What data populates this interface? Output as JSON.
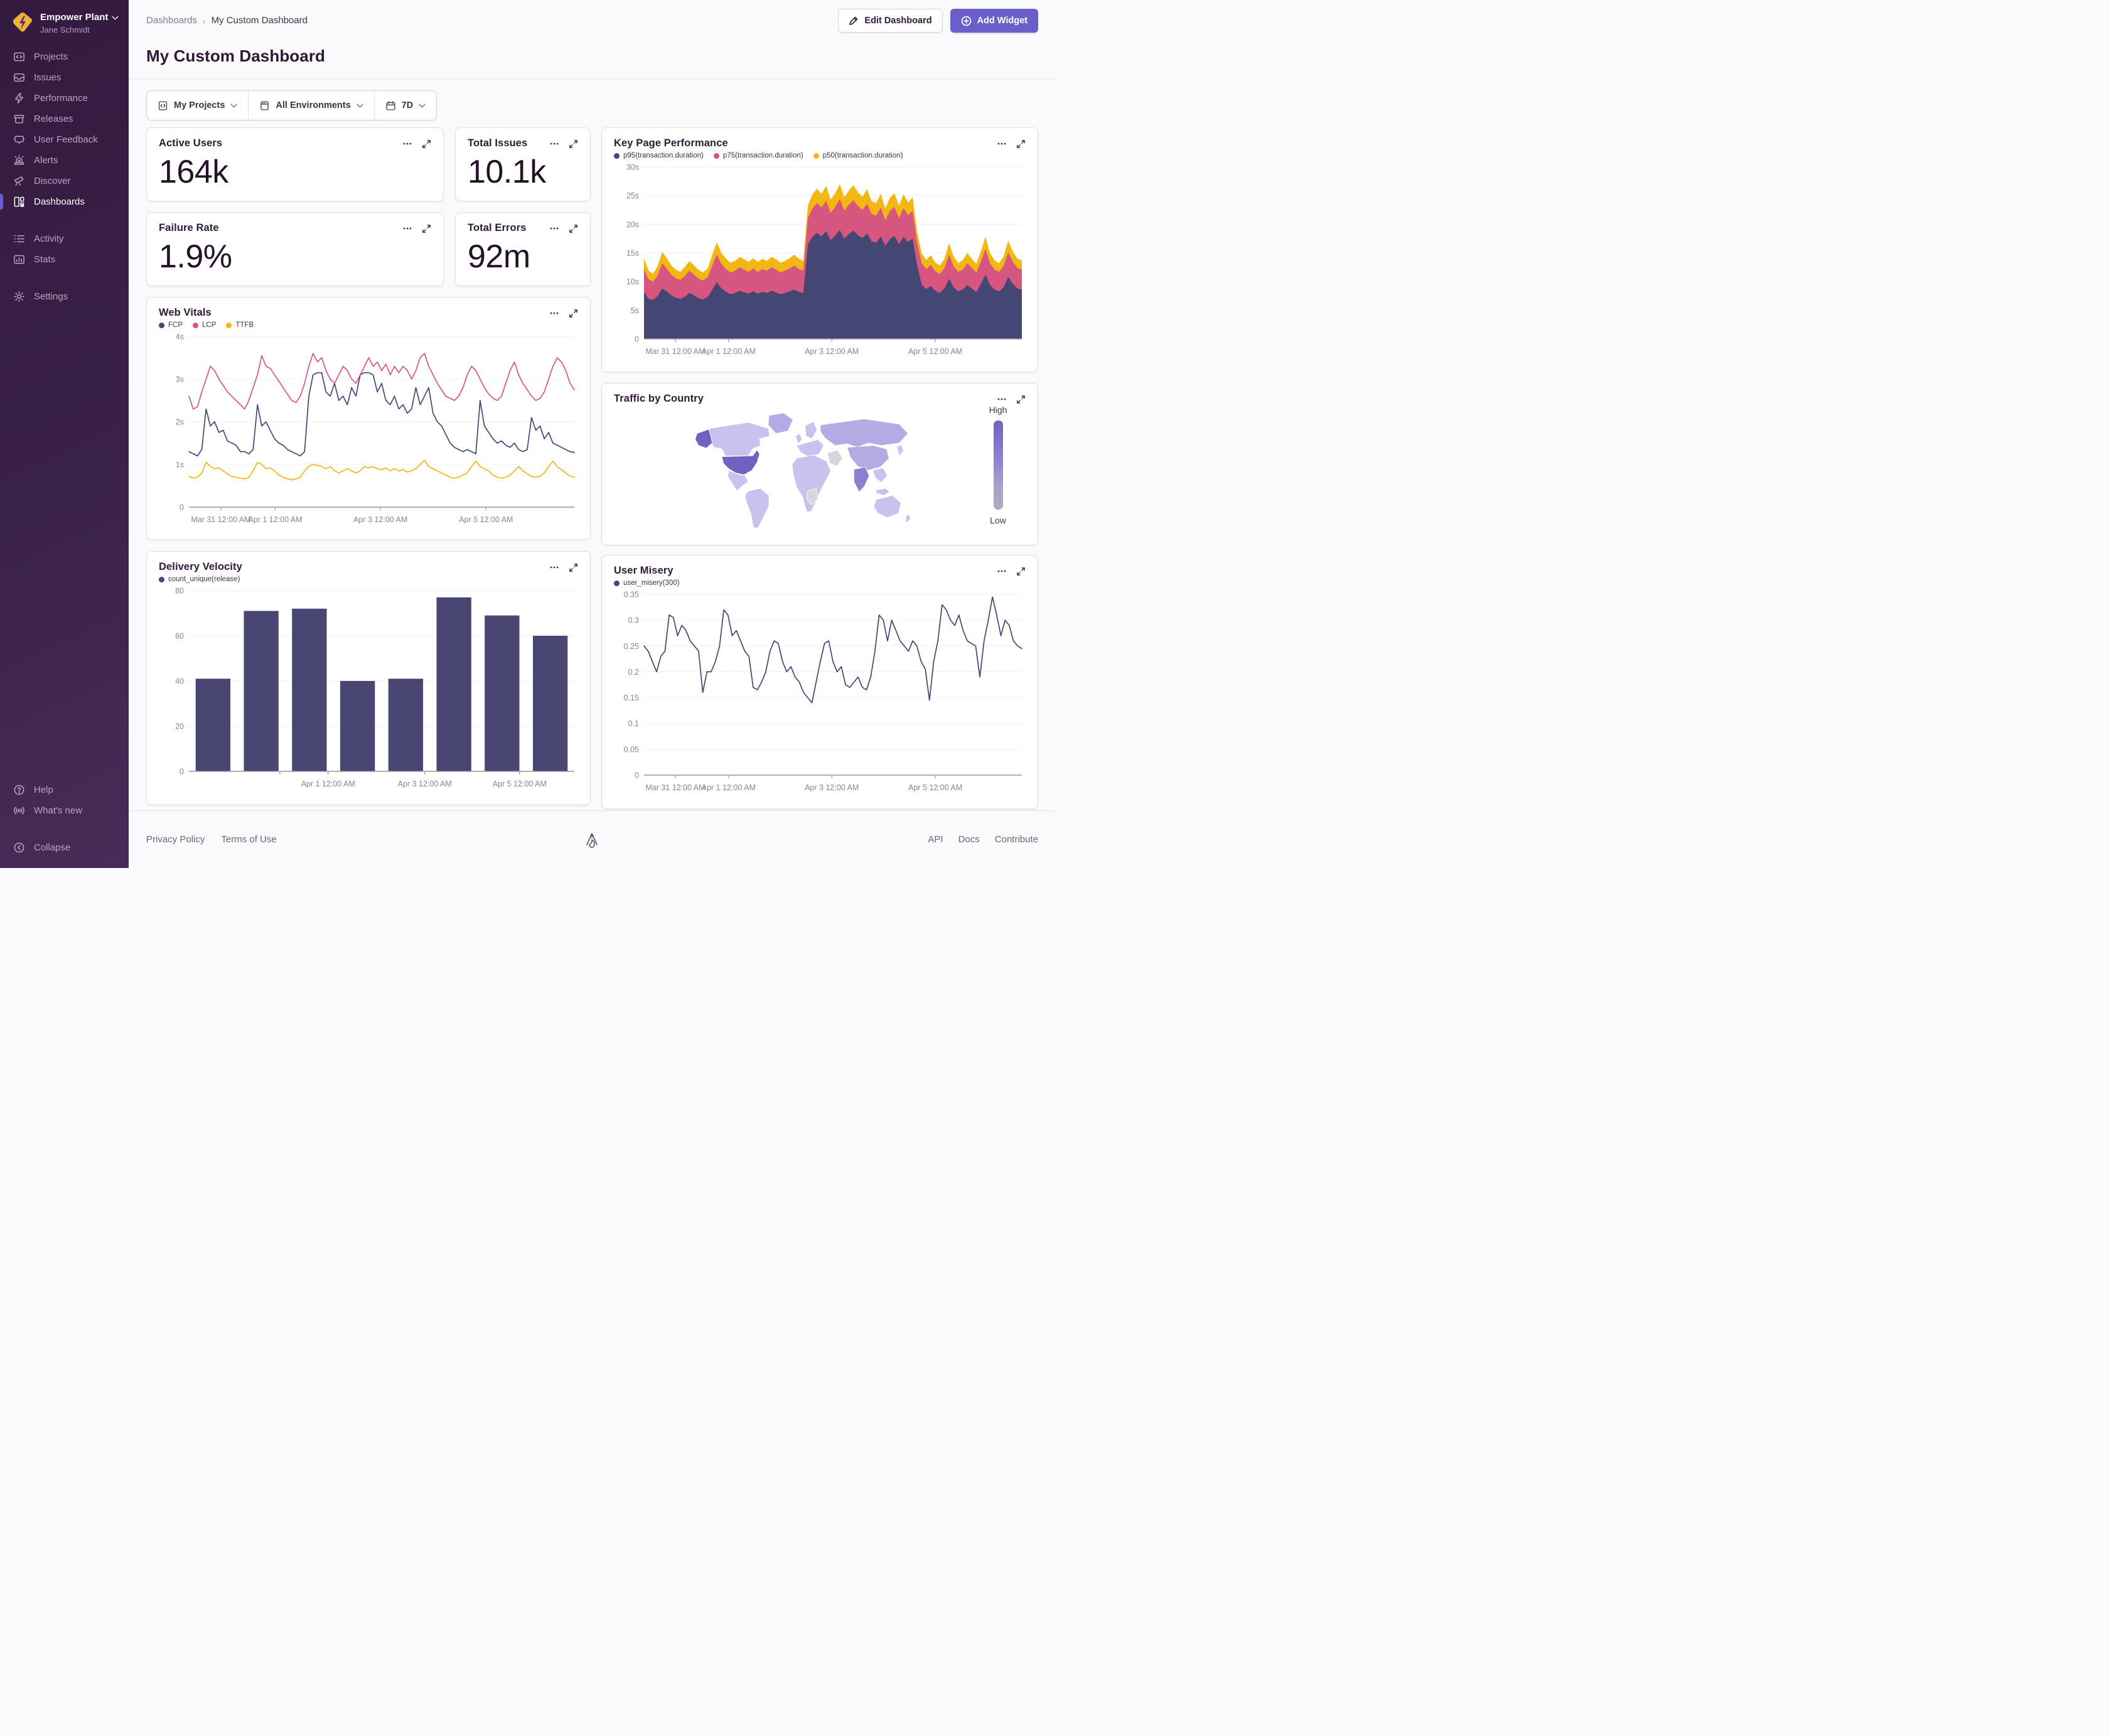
{
  "colors": {
    "accent": "#6a5fc8",
    "navy": "#444674",
    "pink": "#d6567f",
    "yellow": "#f2b712",
    "bar": "#4a4673",
    "map-base": "#c9c2ee",
    "map-mid": "#b3abe4",
    "map-med": "#8d7fd0",
    "map-high": "#6f63c2",
    "map-nodata": "#d8d5de"
  },
  "sidebar": {
    "org": "Empower Plant",
    "user": "Jane Schmidt",
    "items": [
      {
        "label": "Projects"
      },
      {
        "label": "Issues"
      },
      {
        "label": "Performance"
      },
      {
        "label": "Releases"
      },
      {
        "label": "User Feedback"
      },
      {
        "label": "Alerts"
      },
      {
        "label": "Discover"
      },
      {
        "label": "Dashboards",
        "active": true
      }
    ],
    "secondary": [
      {
        "label": "Activity"
      },
      {
        "label": "Stats"
      }
    ],
    "tertiary": [
      {
        "label": "Settings"
      }
    ],
    "bottom": [
      {
        "label": "Help"
      },
      {
        "label": "What's new"
      },
      {
        "label": "Collapse"
      }
    ]
  },
  "header": {
    "breadcrumb": {
      "root": "Dashboards",
      "current": "My Custom Dashboard"
    },
    "title": "My Custom Dashboard",
    "edit_button": "Edit Dashboard",
    "add_button": "Add Widget"
  },
  "filters": {
    "projects": "My Projects",
    "environments": "All Environments",
    "period": "7D"
  },
  "widgets": {
    "big_numbers": [
      {
        "title": "Active Users",
        "value": "164k"
      },
      {
        "title": "Total Issues",
        "value": "10.1k"
      },
      {
        "title": "Failure Rate",
        "value": "1.9%"
      },
      {
        "title": "Total Errors",
        "value": "92m"
      }
    ]
  },
  "map": {
    "title": "Traffic by Country",
    "legend_high": "High",
    "legend_low": "Low"
  },
  "footer": {
    "privacy": "Privacy Policy",
    "terms": "Terms of Use",
    "api": "API",
    "docs": "Docs",
    "contribute": "Contribute"
  },
  "chart_data": [
    {
      "id": "kpp",
      "type": "area",
      "stacked": true,
      "title": "Key Page Performance",
      "ylim": [
        0,
        30
      ],
      "yticks": [
        {
          "v": 0,
          "l": "0"
        },
        {
          "v": 5,
          "l": "5s"
        },
        {
          "v": 10,
          "l": "10s"
        },
        {
          "v": 15,
          "l": "15s"
        },
        {
          "v": 20,
          "l": "20s"
        },
        {
          "v": 25,
          "l": "25s"
        },
        {
          "v": 30,
          "l": "30s"
        }
      ],
      "xticks": [
        {
          "f": 0.083,
          "l": "Mar 31 12:00 AM"
        },
        {
          "f": 0.224,
          "l": "Apr 1 12:00 AM"
        },
        {
          "f": 0.497,
          "l": "Apr 3 12:00 AM"
        },
        {
          "f": 0.771,
          "l": "Apr 5 12:00 AM"
        }
      ],
      "series": [
        {
          "name": "p95(transaction.duration)",
          "color": "navy",
          "values": [
            8.2,
            7.0,
            6.8,
            7.5,
            8.8,
            8.3,
            7.6,
            7.2,
            7.0,
            7.4,
            8.0,
            7.6,
            7.1,
            6.9,
            7.3,
            8.6,
            9.9,
            8.8,
            8.2,
            7.8,
            8.0,
            8.4,
            8.1,
            7.9,
            8.3,
            7.9,
            8.2,
            8.0,
            8.4,
            8.1,
            7.8,
            8.0,
            8.3,
            8.6,
            8.2,
            8.0,
            16.5,
            17.8,
            18.5,
            17.9,
            18.8,
            17.2,
            18.0,
            19.0,
            17.5,
            18.3,
            18.9,
            18.1,
            17.6,
            18.4,
            17.0,
            16.8,
            17.9,
            16.2,
            17.4,
            18.0,
            16.5,
            17.8,
            16.9,
            17.5,
            12.8,
            9.5,
            8.7,
            9.2,
            8.4,
            8.0,
            8.8,
            10.5,
            9.0,
            8.3,
            8.6,
            9.4,
            8.8,
            8.2,
            9.6,
            11.2,
            9.4,
            8.6,
            8.3,
            9.0,
            10.8,
            9.6,
            8.8,
            8.6
          ]
        },
        {
          "name": "p75(transaction.duration)",
          "color": "pink",
          "values": [
            4.0,
            3.4,
            3.2,
            3.6,
            4.4,
            4.0,
            3.6,
            3.4,
            3.3,
            3.6,
            3.9,
            3.6,
            3.4,
            3.3,
            3.5,
            4.2,
            4.8,
            4.3,
            4.0,
            3.8,
            3.9,
            4.1,
            4.0,
            3.8,
            4.0,
            3.8,
            4.0,
            3.9,
            4.1,
            4.0,
            3.8,
            3.9,
            4.0,
            4.2,
            4.0,
            3.9,
            4.6,
            5.0,
            5.2,
            5.0,
            5.3,
            4.8,
            5.0,
            5.4,
            4.9,
            5.1,
            5.3,
            5.1,
            4.9,
            5.2,
            4.8,
            4.7,
            5.0,
            4.5,
            4.9,
            5.0,
            4.6,
            5.0,
            4.7,
            4.9,
            4.0,
            3.7,
            3.5,
            3.7,
            3.4,
            3.3,
            3.6,
            4.2,
            3.7,
            3.4,
            3.5,
            3.8,
            3.6,
            3.4,
            3.9,
            4.5,
            3.8,
            3.5,
            3.4,
            3.7,
            4.3,
            3.9,
            3.6,
            3.5
          ]
        },
        {
          "name": "p50(transaction.duration)",
          "color": "yellow",
          "values": [
            1.8,
            1.5,
            1.4,
            1.6,
            2.0,
            1.8,
            1.6,
            1.5,
            1.4,
            1.6,
            1.7,
            1.6,
            1.5,
            1.4,
            1.5,
            1.9,
            2.2,
            1.9,
            1.8,
            1.7,
            1.7,
            1.8,
            1.8,
            1.7,
            1.8,
            1.7,
            1.8,
            1.7,
            1.8,
            1.8,
            1.7,
            1.7,
            1.8,
            1.9,
            1.8,
            1.7,
            2.2,
            2.4,
            2.5,
            2.4,
            2.6,
            2.3,
            2.4,
            2.6,
            2.3,
            2.5,
            2.6,
            2.4,
            2.3,
            2.5,
            2.2,
            2.2,
            2.4,
            2.1,
            2.3,
            2.4,
            2.2,
            2.4,
            2.2,
            2.3,
            1.9,
            1.7,
            1.6,
            1.7,
            1.5,
            1.5,
            1.6,
            2.0,
            1.7,
            1.5,
            1.6,
            1.8,
            1.6,
            1.5,
            1.8,
            2.1,
            1.8,
            1.6,
            1.5,
            1.7,
            2.0,
            1.8,
            1.6,
            1.6
          ]
        }
      ]
    },
    {
      "id": "webvitals",
      "type": "line",
      "title": "Web Vitals",
      "ylim": [
        0,
        4
      ],
      "yticks": [
        {
          "v": 0,
          "l": "0"
        },
        {
          "v": 1,
          "l": "1s"
        },
        {
          "v": 2,
          "l": "2s"
        },
        {
          "v": 3,
          "l": "3s"
        },
        {
          "v": 4,
          "l": "4s"
        }
      ],
      "xticks": [
        {
          "f": 0.083,
          "l": "Mar 31 12:00 AM"
        },
        {
          "f": 0.224,
          "l": "Apr 1 12:00 AM"
        },
        {
          "f": 0.497,
          "l": "Apr 3 12:00 AM"
        },
        {
          "f": 0.771,
          "l": "Apr 5 12:00 AM"
        }
      ],
      "series": [
        {
          "name": "FCP",
          "color": "navy",
          "values": [
            1.3,
            1.25,
            1.2,
            1.35,
            2.3,
            1.9,
            2.0,
            1.75,
            1.8,
            1.55,
            1.5,
            1.45,
            1.3,
            1.3,
            1.25,
            1.35,
            2.4,
            1.9,
            2.0,
            1.8,
            1.6,
            1.5,
            1.45,
            1.35,
            1.3,
            1.25,
            1.2,
            1.3,
            2.6,
            3.1,
            3.15,
            3.15,
            2.7,
            2.6,
            2.9,
            2.5,
            2.6,
            2.4,
            2.8,
            2.6,
            3.1,
            3.15,
            3.15,
            3.1,
            2.7,
            2.9,
            2.5,
            2.4,
            2.6,
            2.3,
            2.4,
            2.2,
            2.3,
            2.8,
            2.4,
            2.6,
            2.8,
            2.2,
            2.0,
            1.9,
            1.7,
            1.5,
            1.4,
            1.35,
            1.3,
            1.35,
            1.3,
            1.25,
            2.5,
            1.9,
            1.75,
            1.6,
            1.5,
            1.55,
            1.45,
            1.4,
            1.5,
            1.35,
            1.3,
            1.35,
            2.1,
            1.8,
            1.9,
            1.6,
            1.75,
            1.5,
            1.45,
            1.4,
            1.35,
            1.3,
            1.28
          ]
        },
        {
          "name": "LCP",
          "color": "pink",
          "values": [
            2.6,
            2.3,
            2.35,
            2.7,
            3.0,
            3.3,
            3.2,
            3.0,
            2.85,
            2.7,
            2.6,
            2.5,
            2.4,
            2.3,
            2.5,
            2.8,
            3.1,
            3.55,
            3.3,
            3.25,
            3.1,
            2.95,
            2.8,
            2.65,
            2.5,
            2.45,
            2.6,
            2.9,
            3.3,
            3.6,
            3.4,
            3.5,
            3.2,
            3.0,
            2.9,
            3.1,
            3.3,
            3.2,
            3.0,
            2.9,
            3.1,
            3.3,
            3.5,
            3.3,
            3.4,
            3.2,
            3.35,
            3.1,
            3.3,
            3.15,
            3.3,
            3.2,
            3.0,
            3.2,
            3.5,
            3.6,
            3.3,
            3.1,
            2.9,
            2.75,
            2.6,
            2.55,
            2.5,
            2.6,
            2.8,
            3.1,
            3.3,
            3.2,
            3.0,
            2.8,
            2.65,
            2.55,
            2.5,
            2.6,
            2.9,
            3.2,
            3.4,
            3.1,
            2.9,
            2.75,
            2.6,
            2.5,
            2.55,
            2.7,
            3.0,
            3.3,
            3.5,
            3.4,
            3.2,
            2.9,
            2.75
          ]
        },
        {
          "name": "TTFB",
          "color": "yellow",
          "values": [
            0.72,
            0.68,
            0.7,
            0.8,
            1.05,
            0.95,
            0.9,
            0.92,
            0.85,
            0.78,
            0.72,
            0.7,
            0.68,
            0.66,
            0.7,
            0.85,
            1.05,
            1.0,
            0.9,
            0.92,
            0.85,
            0.75,
            0.7,
            0.66,
            0.64,
            0.66,
            0.7,
            0.85,
            0.95,
            1.0,
            0.98,
            0.95,
            0.9,
            0.95,
            0.85,
            0.8,
            0.85,
            0.9,
            0.85,
            0.8,
            0.85,
            0.95,
            0.92,
            0.95,
            0.9,
            0.88,
            0.92,
            0.85,
            0.9,
            0.85,
            0.88,
            0.82,
            0.85,
            0.9,
            1.0,
            1.1,
            0.95,
            0.9,
            0.85,
            0.8,
            0.75,
            0.7,
            0.68,
            0.7,
            0.75,
            0.8,
            0.95,
            1.08,
            0.95,
            0.9,
            0.85,
            0.75,
            0.7,
            0.68,
            0.7,
            0.75,
            0.85,
            0.95,
            0.85,
            0.78,
            0.72,
            0.7,
            0.72,
            0.8,
            0.95,
            1.08,
            0.95,
            0.88,
            0.8,
            0.73,
            0.7
          ]
        }
      ]
    },
    {
      "id": "traffic",
      "type": "choropleth",
      "title": "Traffic by Country",
      "legend": {
        "high": "High",
        "low": "Low"
      },
      "countries": {
        "United States": "high",
        "Alaska (US)": "high",
        "India": "medium",
        "Russia": "mid",
        "Greenland": "mid",
        "Canada": "low",
        "Brazil": "low",
        "Australia": "low",
        "China": "mid",
        "Iran": "no-data",
        "DR Congo": "no-data",
        "Europe": "low",
        "Africa": "low"
      }
    },
    {
      "id": "delivery",
      "type": "bar",
      "title": "Delivery Velocity",
      "ylim": [
        0,
        80
      ],
      "yticks": [
        {
          "v": 0,
          "l": "0"
        },
        {
          "v": 20,
          "l": "20"
        },
        {
          "v": 40,
          "l": "40"
        },
        {
          "v": 60,
          "l": "60"
        },
        {
          "v": 80,
          "l": "80"
        }
      ],
      "xticks": [
        {
          "f": 0.236,
          "l": ""
        },
        {
          "f": 0.361,
          "l": "Apr 1 12:00 AM"
        },
        {
          "f": 0.612,
          "l": "Apr 3 12:00 AM"
        },
        {
          "f": 0.858,
          "l": "Apr 5 12:00 AM"
        }
      ],
      "series": [
        {
          "name": "count_unique(release)",
          "color": "bar",
          "values": [
            41,
            71,
            72,
            40,
            41,
            77,
            69,
            60
          ]
        }
      ]
    },
    {
      "id": "misery",
      "type": "line",
      "title": "User Misery",
      "ylim": [
        0,
        0.35
      ],
      "yticks": [
        {
          "v": 0,
          "l": "0"
        },
        {
          "v": 0.05,
          "l": "0.05"
        },
        {
          "v": 0.1,
          "l": "0.1"
        },
        {
          "v": 0.15,
          "l": "0.15"
        },
        {
          "v": 0.2,
          "l": "0.2"
        },
        {
          "v": 0.25,
          "l": "0.25"
        },
        {
          "v": 0.3,
          "l": "0.3"
        },
        {
          "v": 0.35,
          "l": "0.35"
        }
      ],
      "xticks": [
        {
          "f": 0.083,
          "l": "Mar 31 12:00 AM"
        },
        {
          "f": 0.224,
          "l": "Apr 1 12:00 AM"
        },
        {
          "f": 0.497,
          "l": "Apr 3 12:00 AM"
        },
        {
          "f": 0.771,
          "l": "Apr 5 12:00 AM"
        }
      ],
      "series": [
        {
          "name": "user_misery(300)",
          "color": "navy",
          "values": [
            0.25,
            0.24,
            0.22,
            0.2,
            0.23,
            0.24,
            0.31,
            0.305,
            0.27,
            0.29,
            0.28,
            0.26,
            0.25,
            0.24,
            0.16,
            0.2,
            0.2,
            0.22,
            0.25,
            0.32,
            0.31,
            0.27,
            0.28,
            0.26,
            0.24,
            0.23,
            0.17,
            0.165,
            0.18,
            0.2,
            0.24,
            0.26,
            0.255,
            0.22,
            0.2,
            0.21,
            0.19,
            0.18,
            0.16,
            0.15,
            0.14,
            0.18,
            0.22,
            0.255,
            0.26,
            0.22,
            0.2,
            0.21,
            0.175,
            0.17,
            0.18,
            0.19,
            0.17,
            0.165,
            0.19,
            0.24,
            0.31,
            0.3,
            0.26,
            0.3,
            0.28,
            0.26,
            0.25,
            0.24,
            0.26,
            0.25,
            0.22,
            0.205,
            0.145,
            0.22,
            0.26,
            0.33,
            0.32,
            0.3,
            0.29,
            0.31,
            0.28,
            0.26,
            0.255,
            0.25,
            0.19,
            0.26,
            0.3,
            0.345,
            0.31,
            0.27,
            0.3,
            0.29,
            0.26,
            0.25,
            0.245
          ]
        }
      ]
    }
  ]
}
